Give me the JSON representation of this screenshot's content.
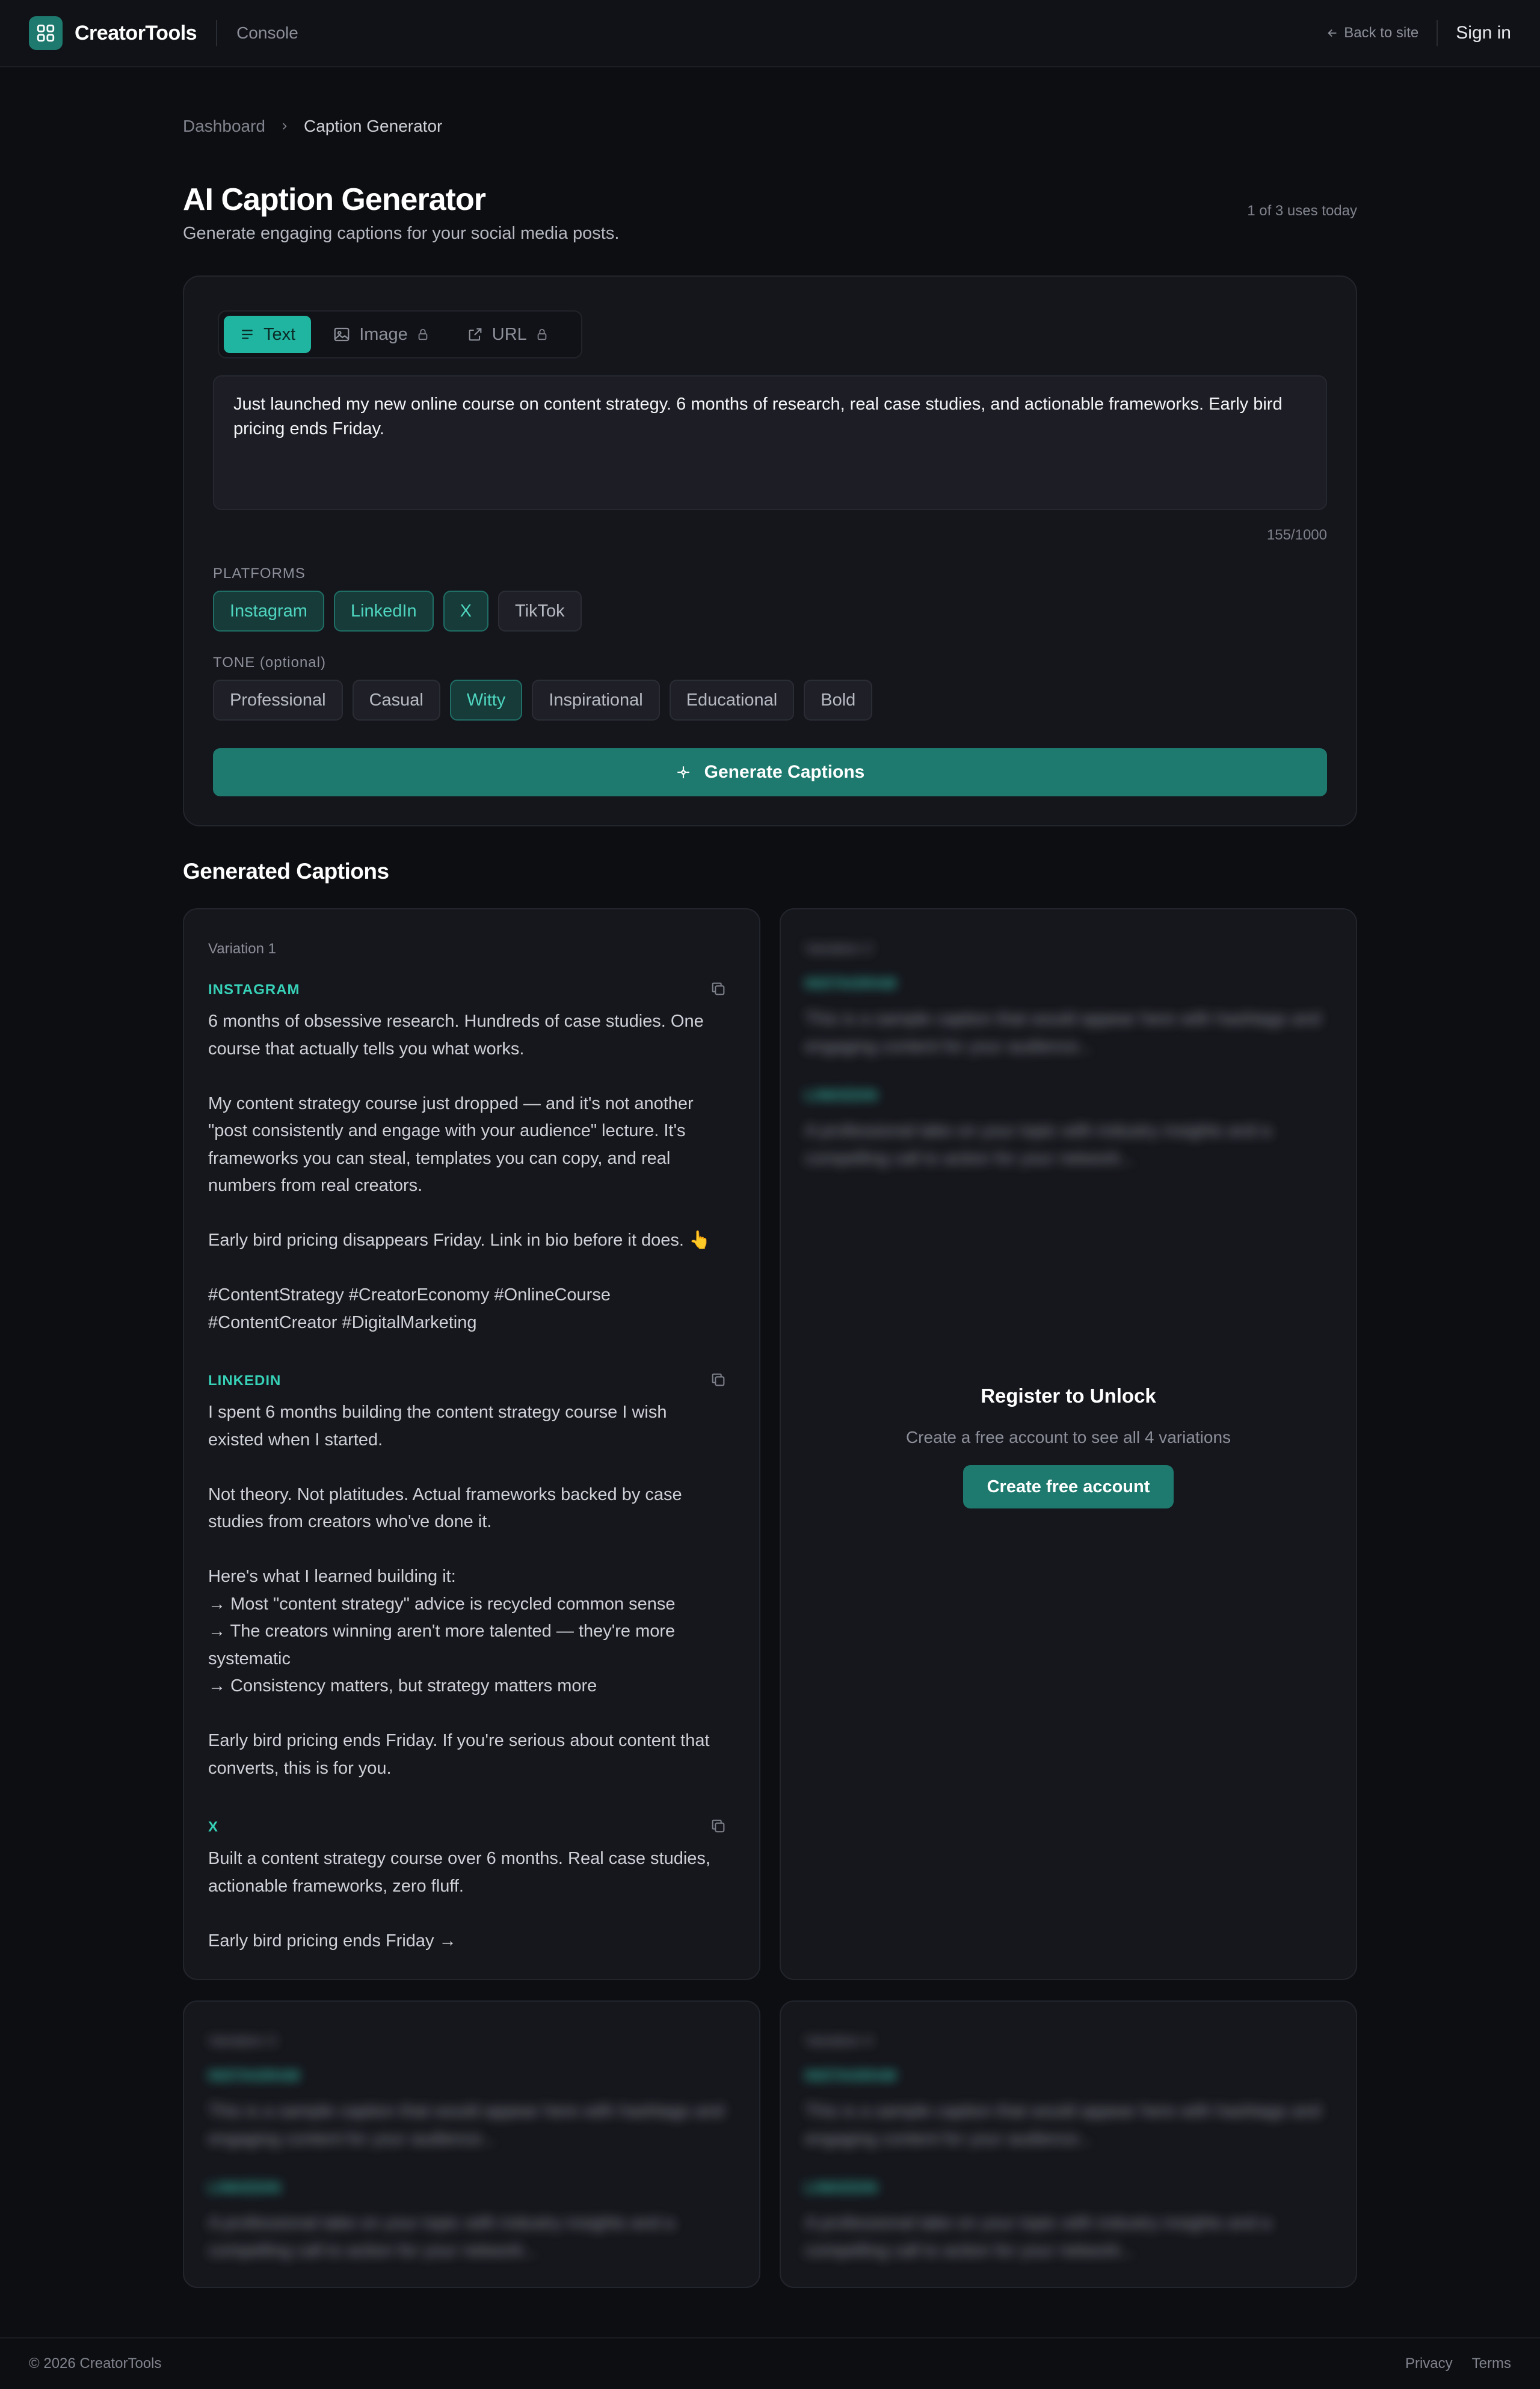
{
  "header": {
    "brand": "CreatorTools",
    "section": "Console",
    "back_label": "Back to site",
    "signin_label": "Sign in"
  },
  "breadcrumb": {
    "parent": "Dashboard",
    "current": "Caption Generator"
  },
  "page": {
    "title": "AI Caption Generator",
    "subtitle": "Generate engaging captions for your social media posts.",
    "usage": "1 of 3 uses today"
  },
  "input": {
    "tabs": [
      {
        "label": "Text",
        "icon": "lines-icon",
        "active": true,
        "locked": false
      },
      {
        "label": "Image",
        "icon": "image-icon",
        "active": false,
        "locked": true
      },
      {
        "label": "URL",
        "icon": "external-link-icon",
        "active": false,
        "locked": true
      }
    ],
    "text": "Just launched my new online course on content strategy. 6 months of research, real case studies, and actionable frameworks. Early bird pricing ends Friday.",
    "char_count": "155/1000",
    "platforms_label": "PLATFORMS",
    "platforms": [
      {
        "label": "Instagram",
        "selected": true
      },
      {
        "label": "LinkedIn",
        "selected": true
      },
      {
        "label": "X",
        "selected": true
      },
      {
        "label": "TikTok",
        "selected": false
      }
    ],
    "tone_label": "TONE (optional)",
    "tones": [
      {
        "label": "Professional",
        "selected": false
      },
      {
        "label": "Casual",
        "selected": false
      },
      {
        "label": "Witty",
        "selected": true
      },
      {
        "label": "Inspirational",
        "selected": false
      },
      {
        "label": "Educational",
        "selected": false
      },
      {
        "label": "Bold",
        "selected": false
      }
    ],
    "generate_label": "Generate Captions"
  },
  "results": {
    "title": "Generated Captions",
    "variation1": {
      "label": "Variation 1",
      "instagram_label": "INSTAGRAM",
      "instagram_text": "6 months of obsessive research. Hundreds of case studies. One course that actually tells you what works.\n\nMy content strategy course just dropped — and it's not another \"post consistently and engage with your audience\" lecture. It's frameworks you can steal, templates you can copy, and real numbers from real creators.\n\nEarly bird pricing disappears Friday. Link in bio before it does. 👆\n\n#ContentStrategy #CreatorEconomy #OnlineCourse #ContentCreator #DigitalMarketing",
      "linkedin_label": "LINKEDIN",
      "linkedin_text": "I spent 6 months building the content strategy course I wish existed when I started.\n\nNot theory. Not platitudes. Actual frameworks backed by case studies from creators who've done it.\n\nHere's what I learned building it:\n→ Most \"content strategy\" advice is recycled common sense\n→ The creators winning aren't more talented — they're more systematic\n→ Consistency matters, but strategy matters more\n\nEarly bird pricing ends Friday. If you're serious about content that converts, this is for you.",
      "x_label": "X",
      "x_text": "Built a content strategy course over 6 months. Real case studies, actionable frameworks, zero fluff.\n\nEarly bird pricing ends Friday →"
    },
    "locked_placeholder": {
      "variation2_label": "Variation 2",
      "variation3_label": "Variation 3",
      "variation4_label": "Variation 4",
      "instagram_label": "INSTAGRAM",
      "instagram_text": "This is a sample caption that would appear here with hashtags and engaging content for your audience...",
      "linkedin_label": "LINKEDIN",
      "linkedin_text": "A professional take on your topic with industry insights and a compelling call to action for your network..."
    },
    "unlock": {
      "title": "Register to Unlock",
      "subtitle": "Create a free account to see all 4 variations",
      "button": "Create free account"
    }
  },
  "footer": {
    "copyright": "© 2026 CreatorTools",
    "privacy": "Privacy",
    "terms": "Terms"
  },
  "colors": {
    "accent": "#20b5a0",
    "accent_dark": "#1e7a6e",
    "background": "#0d0e12",
    "card": "#16171d"
  }
}
